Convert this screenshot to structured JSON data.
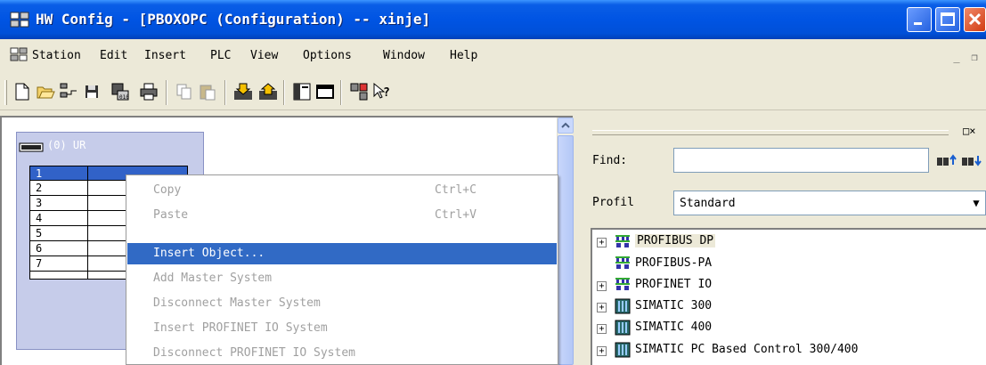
{
  "window": {
    "title": "HW Config - [PBOXOPC (Configuration) -- xinje]"
  },
  "menubar": {
    "items": [
      "Station",
      "Edit",
      "Insert",
      "PLC",
      "View",
      "Options",
      "Window",
      "Help"
    ],
    "mdi_minimize": "_",
    "mdi_restore": "❐"
  },
  "toolbar": {
    "icons": [
      "new-icon",
      "open-icon",
      "network-icon",
      "save-icon",
      "compile-icon",
      "print-icon",
      "copy-icon",
      "paste-icon",
      "download-icon",
      "upload-icon",
      "catalog-icon",
      "monitor-icon",
      "netpro-icon",
      "help-icon"
    ]
  },
  "station": {
    "rack_title": "(0) UR",
    "slots": [
      "1",
      "2",
      "3",
      "4",
      "5",
      "6",
      "7",
      ""
    ],
    "selected_slot": "1"
  },
  "context_menu": {
    "items": [
      {
        "label": "Copy",
        "shortcut": "Ctrl+C",
        "state": "disabled"
      },
      {
        "label": "Paste",
        "shortcut": "Ctrl+V",
        "state": "disabled"
      },
      {
        "label": "Insert Object...",
        "shortcut": "",
        "state": "highlighted"
      },
      {
        "label": "Add Master System",
        "shortcut": "",
        "state": "disabled"
      },
      {
        "label": "Disconnect Master System",
        "shortcut": "",
        "state": "disabled"
      },
      {
        "label": "Insert PROFINET IO System",
        "shortcut": "",
        "state": "disabled"
      },
      {
        "label": "Disconnect PROFINET IO System",
        "shortcut": "",
        "state": "disabled"
      }
    ]
  },
  "catalog": {
    "find_label": "Find:",
    "find_value": "",
    "profil_label": "Profil",
    "profil_value": "Standard",
    "panel_buttons": "□×",
    "tree": [
      {
        "label": "PROFIBUS DP",
        "icon": "profibus-icon",
        "expandable": true
      },
      {
        "label": "PROFIBUS-PA",
        "icon": "profibus-icon",
        "expandable": false
      },
      {
        "label": "PROFINET IO",
        "icon": "profinet-icon",
        "expandable": true
      },
      {
        "label": "SIMATIC 300",
        "icon": "simatic-icon",
        "expandable": true
      },
      {
        "label": "SIMATIC 400",
        "icon": "simatic-icon",
        "expandable": true
      },
      {
        "label": "SIMATIC PC Based Control 300/400",
        "icon": "simatic-icon",
        "expandable": true
      }
    ]
  },
  "colors": {
    "titlebar": "#0054e3",
    "selection": "#316ac5",
    "rack_bg": "#c6ccea"
  }
}
